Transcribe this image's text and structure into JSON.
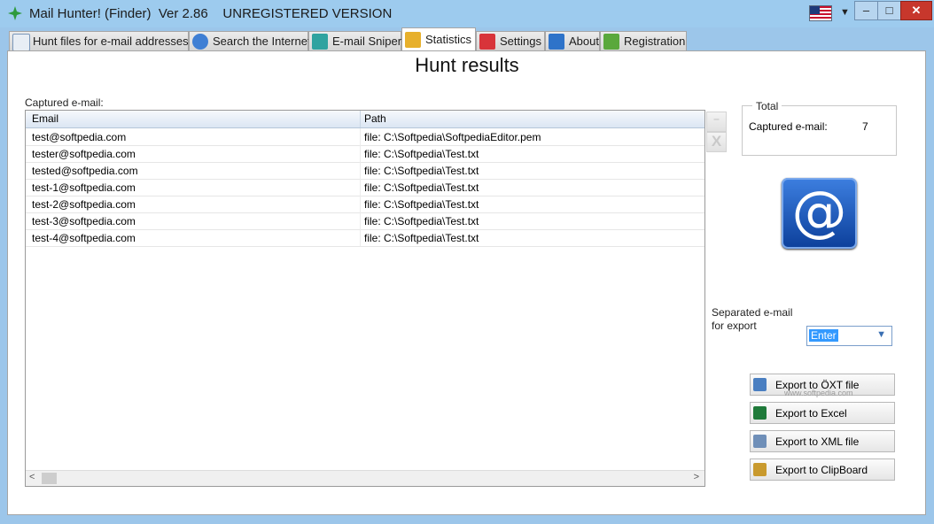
{
  "window": {
    "title": "Mail Hunter! (Finder)  Ver 2.86    UNREGISTERED VERSION",
    "controls": {
      "minimize": "–",
      "maximize": "□",
      "close": "✕"
    },
    "language_flag": "us-flag-icon"
  },
  "tabs": [
    {
      "label": "Hunt files for e-mail addresses",
      "icon": "document-icon",
      "color": "#e8eef5"
    },
    {
      "label": "Search the Internet",
      "icon": "globe-icon",
      "color": "#3f7fd4"
    },
    {
      "label": "E-mail Sniper",
      "icon": "magnifier-icon",
      "color": "#2fa3a0"
    },
    {
      "label": "Statistics",
      "icon": "coins-icon",
      "color": "#e7b02c",
      "active": true
    },
    {
      "label": "Settings",
      "icon": "gear-icon",
      "color": "#d8343a"
    },
    {
      "label": "About",
      "icon": "book-icon",
      "color": "#2e73c9"
    },
    {
      "label": "Registration",
      "icon": "user-icon",
      "color": "#5aa83c"
    }
  ],
  "page": {
    "heading": "Hunt results",
    "captured_caption": "Captured e-mail:"
  },
  "grid": {
    "columns": [
      "Email",
      "Path"
    ],
    "rows": [
      [
        "test@softpedia.com",
        "file: C:\\Softpedia\\SoftpediaEditor.pem"
      ],
      [
        "tester@softpedia.com",
        "file: C:\\Softpedia\\Test.txt"
      ],
      [
        "tested@softpedia.com",
        "file: C:\\Softpedia\\Test.txt"
      ],
      [
        "test-1@softpedia.com",
        "file: C:\\Softpedia\\Test.txt"
      ],
      [
        "test-2@softpedia.com",
        "file: C:\\Softpedia\\Test.txt"
      ],
      [
        "test-3@softpedia.com",
        "file: C:\\Softpedia\\Test.txt"
      ],
      [
        "test-4@softpedia.com",
        "file: C:\\Softpedia\\Test.txt"
      ]
    ],
    "scroll_left": "<",
    "scroll_right": ">"
  },
  "side_buttons": {
    "remove": "–",
    "clear": "X"
  },
  "total": {
    "legend": "Total",
    "label": "Captured e-mail:",
    "value": "7"
  },
  "at_symbol": "@",
  "export": {
    "separator_label": "Separated e-mail\nfor export",
    "separator_value": "Enter",
    "buttons": [
      {
        "label": "Export to ÖXT file",
        "icon": "text-file-icon",
        "color": "#4a7fc1"
      },
      {
        "label": "Export to Excel",
        "icon": "excel-icon",
        "color": "#1f7a3a"
      },
      {
        "label": "Export to XML file",
        "icon": "xml-file-icon",
        "color": "#6f8fb8"
      },
      {
        "label": "Export to ClipBoard",
        "icon": "clipboard-icon",
        "color": "#c99a2e"
      }
    ]
  },
  "watermark": "www.softpedia.com"
}
